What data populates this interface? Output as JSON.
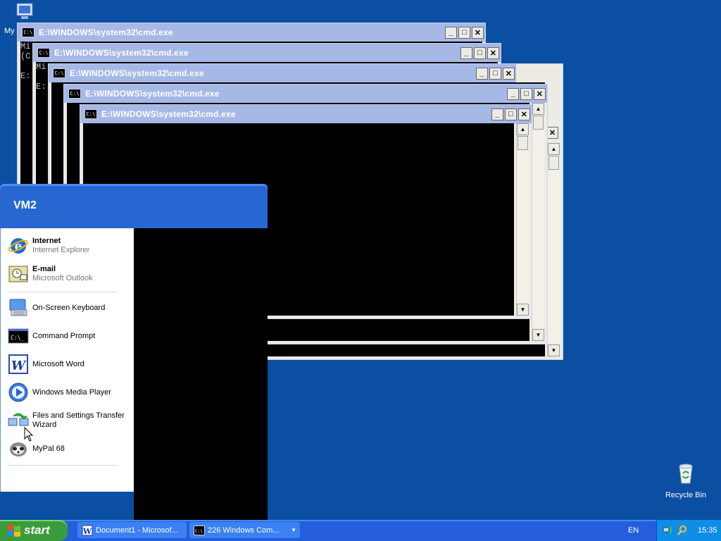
{
  "desktop": {
    "icons": [
      {
        "label": "My",
        "icon": "computer-icon"
      },
      {
        "label": "Recycle Bin",
        "icon": "recycle-bin-icon"
      }
    ]
  },
  "cmd_windows": [
    {
      "title": "E:\\WINDOWS\\system32\\cmd.exe",
      "text": "Mi\n(C\n\nE:"
    },
    {
      "title": "E:\\WINDOWS\\system32\\cmd.exe",
      "text": "Mi\n\nE:"
    },
    {
      "title": "E:\\WINDOWS\\system32\\cmd.exe",
      "text": ""
    },
    {
      "title": "E:\\WINDOWS\\system32\\cmd.exe",
      "text": ""
    },
    {
      "title": "E:\\WINDOWS\\system32\\cmd.exe",
      "text": ""
    }
  ],
  "window_buttons": {
    "minimize": "_",
    "maximize": "□",
    "close": "✕"
  },
  "start_menu": {
    "user": "VM2",
    "pinned": [
      {
        "main": "Internet",
        "sub": "Internet Explorer",
        "icon": "internet-explorer-icon"
      },
      {
        "main": "E-mail",
        "sub": "Microsoft Outlook",
        "icon": "outlook-icon"
      }
    ],
    "recent": [
      {
        "label": "On-Screen Keyboard",
        "icon": "keyboard-icon"
      },
      {
        "label": "Command Prompt",
        "icon": "command-prompt-icon"
      },
      {
        "label": "Microsoft Word",
        "icon": "word-icon"
      },
      {
        "label": "Windows Media Player",
        "icon": "media-player-icon"
      },
      {
        "label": "Files and Settings Transfer Wizard",
        "icon": "transfer-wizard-icon"
      },
      {
        "label": "MyPal 68",
        "icon": "mypal-icon"
      }
    ]
  },
  "taskbar": {
    "start_label": "start",
    "buttons": [
      {
        "label": "Document1 - Microsof...",
        "icon": "word-icon"
      },
      {
        "label": "226  Windows Com...",
        "icon": "command-prompt-icon"
      }
    ],
    "language": "EN",
    "clock": "15:35"
  },
  "colors": {
    "desktop": "#0a4fa1",
    "taskbar": "#245edb",
    "start_button": "#3a9b3a"
  }
}
